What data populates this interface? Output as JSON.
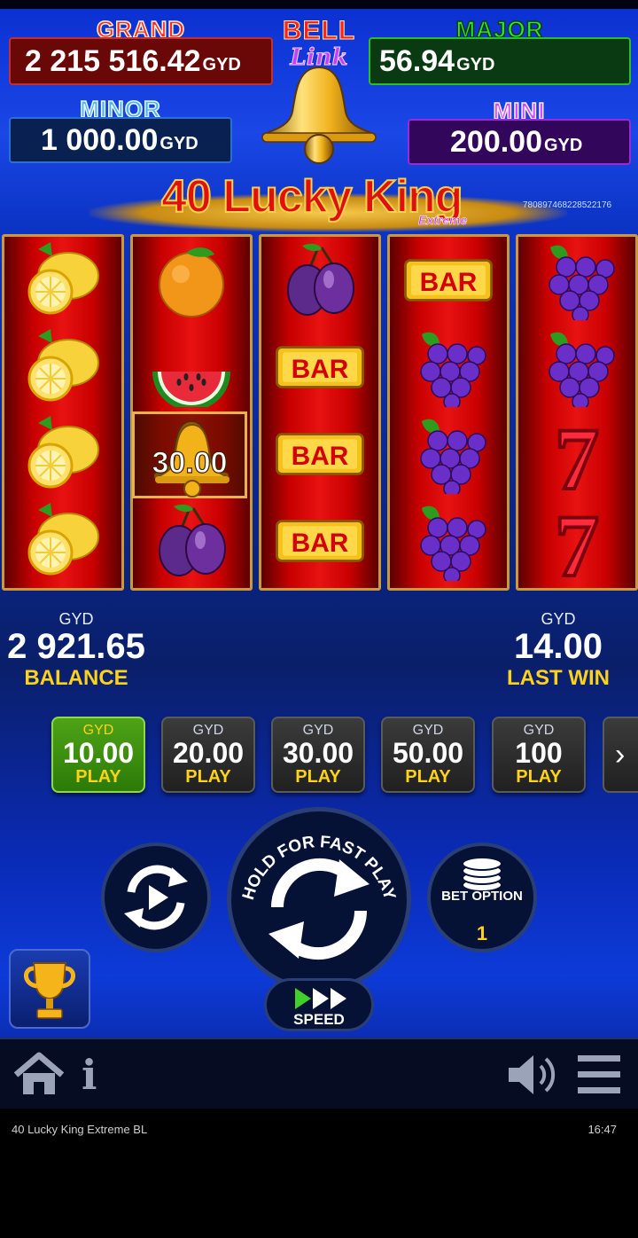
{
  "jackpots": {
    "grand": {
      "label": "GRAND",
      "value": "2 215 516.42",
      "currency": "GYD"
    },
    "major": {
      "label": "MAJOR",
      "value": "56.94",
      "currency": "GYD"
    },
    "minor": {
      "label": "MINOR",
      "value": "1 000.00",
      "currency": "GYD"
    },
    "mini": {
      "label": "MINI",
      "value": "200.00",
      "currency": "GYD"
    }
  },
  "logo": {
    "bell": "BELL",
    "link": "Link"
  },
  "title": {
    "main": "40 Lucky King",
    "sub": "Extreme",
    "id": "7808974682285221​76"
  },
  "reels": [
    [
      "lemon",
      "lemon",
      "lemon",
      "lemon"
    ],
    [
      "orange",
      "watermelon",
      "bell",
      "plum"
    ],
    [
      "plum",
      "bar",
      "bar",
      "bar"
    ],
    [
      "bar",
      "grapes",
      "grapes",
      "grapes"
    ],
    [
      "grapes",
      "grapes",
      "seven",
      "seven"
    ]
  ],
  "symbol_text": {
    "bar": "BAR",
    "seven": "7"
  },
  "win_highlight": {
    "amount": "30.00"
  },
  "balance": {
    "currency": "GYD",
    "value": "2 921.65",
    "label": "BALANCE"
  },
  "last_win": {
    "currency": "GYD",
    "value": "14.00",
    "label": "LAST WIN"
  },
  "bets": [
    {
      "currency": "GYD",
      "value": "10.00",
      "play": "PLAY",
      "active": true
    },
    {
      "currency": "GYD",
      "value": "20.00",
      "play": "PLAY",
      "active": false
    },
    {
      "currency": "GYD",
      "value": "30.00",
      "play": "PLAY",
      "active": false
    },
    {
      "currency": "GYD",
      "value": "50.00",
      "play": "PLAY",
      "active": false
    },
    {
      "currency": "GYD",
      "value": "100",
      "play": "PLAY",
      "active": false
    }
  ],
  "controls": {
    "spin_hint": "HOLD FOR FAST PLAY",
    "bet_option_label": "BET OPTION",
    "bet_option_value": "1",
    "speed_label": "SPEED"
  },
  "nav": {
    "info_label": "i"
  },
  "status": {
    "title": "40 Lucky King Extreme BL",
    "clock": "16:47"
  },
  "colors": {
    "accent_yellow": "#ffd21a",
    "active_bet": "#4ea316",
    "reel_red": "#d60000"
  }
}
